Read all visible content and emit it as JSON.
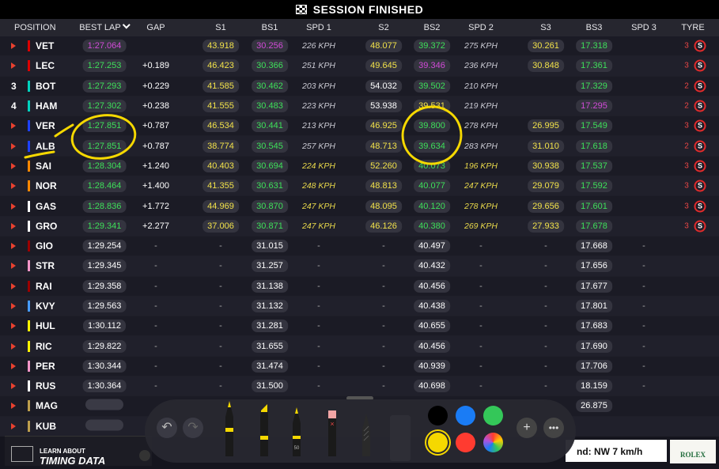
{
  "session": {
    "title": "SESSION FINISHED"
  },
  "columns": [
    "POSITION",
    "BEST LAP",
    "GAP",
    "S1",
    "BS1",
    "SPD 1",
    "S2",
    "BS2",
    "SPD 2",
    "S3",
    "BS3",
    "SPD 3",
    "TYRE"
  ],
  "colors": {
    "team_red": "#e8412f",
    "fastest_purple": "#d34bd9",
    "personal_green": "#3ee05a",
    "sector_yellow": "#f2e24a",
    "annotation_yellow": "#f5d800"
  },
  "rows": [
    {
      "pos": "",
      "team": "#dc0000",
      "driver": "VET",
      "lap": "1:27.064",
      "gap": "",
      "s1": "43.918",
      "bs1": "30.256",
      "spd1": "226 KPH",
      "s2": "48.077",
      "bs2": "39.372",
      "spd2": "275 KPH",
      "s3": "30.261",
      "bs3": "17.318",
      "spd3": "",
      "laps": "3",
      "tyre": "S"
    },
    {
      "pos": "",
      "team": "#dc0000",
      "driver": "LEC",
      "lap": "1:27.253",
      "gap": "+0.189",
      "s1": "46.423",
      "bs1": "30.366",
      "spd1": "251 KPH",
      "s2": "49.645",
      "bs2": "39.346",
      "spd2": "236 KPH",
      "s3": "30.848",
      "bs3": "17.361",
      "spd3": "",
      "laps": "3",
      "tyre": "S"
    },
    {
      "pos": "3",
      "team": "#00d2be",
      "driver": "BOT",
      "lap": "1:27.293",
      "gap": "+0.229",
      "s1": "41.585",
      "bs1": "30.462",
      "spd1": "203 KPH",
      "s2": "54.032",
      "bs2": "39.502",
      "spd2": "210 KPH",
      "s3": "",
      "bs3": "17.329",
      "spd3": "",
      "laps": "2",
      "tyre": "S"
    },
    {
      "pos": "4",
      "team": "#00d2be",
      "driver": "HAM",
      "lap": "1:27.302",
      "gap": "+0.238",
      "s1": "41.555",
      "bs1": "30.483",
      "spd1": "223 KPH",
      "s2": "53.938",
      "bs2": "39.531",
      "spd2": "219 KPH",
      "s3": "",
      "bs3": "17.295",
      "spd3": "",
      "laps": "2",
      "tyre": "S"
    },
    {
      "pos": "",
      "team": "#1e41ff",
      "driver": "VER",
      "lap": "1:27.851",
      "gap": "+0.787",
      "s1": "46.534",
      "bs1": "30.441",
      "spd1": "213 KPH",
      "s2": "46.925",
      "bs2": "39.800",
      "spd2": "278 KPH",
      "s3": "26.995",
      "bs3": "17.549",
      "spd3": "",
      "laps": "3",
      "tyre": "S"
    },
    {
      "pos": "",
      "team": "#1e41ff",
      "driver": "ALB",
      "lap": "1:27.851",
      "gap": "+0.787",
      "s1": "38.774",
      "bs1": "30.545",
      "spd1": "257 KPH",
      "s2": "48.713",
      "bs2": "39.634",
      "spd2": "283 KPH",
      "s3": "31.010",
      "bs3": "17.618",
      "spd3": "",
      "laps": "2",
      "tyre": "S"
    },
    {
      "pos": "",
      "team": "#ff8700",
      "driver": "SAI",
      "lap": "1:28.304",
      "gap": "+1.240",
      "s1": "40.403",
      "bs1": "30.694",
      "spd1": "224 KPH",
      "s2": "52.260",
      "bs2": "40.073",
      "spd2": "196 KPH",
      "s3": "30.938",
      "bs3": "17.537",
      "spd3": "",
      "laps": "3",
      "tyre": "S"
    },
    {
      "pos": "",
      "team": "#ff8700",
      "driver": "NOR",
      "lap": "1:28.464",
      "gap": "+1.400",
      "s1": "41.355",
      "bs1": "30.631",
      "spd1": "248 KPH",
      "s2": "48.813",
      "bs2": "40.077",
      "spd2": "247 KPH",
      "s3": "29.079",
      "bs3": "17.592",
      "spd3": "",
      "laps": "3",
      "tyre": "S"
    },
    {
      "pos": "",
      "team": "#ffffff",
      "driver": "GAS",
      "lap": "1:28.836",
      "gap": "+1.772",
      "s1": "44.969",
      "bs1": "30.870",
      "spd1": "247 KPH",
      "s2": "48.095",
      "bs2": "40.120",
      "spd2": "278 KPH",
      "s3": "29.656",
      "bs3": "17.601",
      "spd3": "",
      "laps": "3",
      "tyre": "S"
    },
    {
      "pos": "",
      "team": "#ffffff",
      "driver": "GRO",
      "lap": "1:29.341",
      "gap": "+2.277",
      "s1": "37.006",
      "bs1": "30.871",
      "spd1": "247 KPH",
      "s2": "46.126",
      "bs2": "40.380",
      "spd2": "269 KPH",
      "s3": "27.933",
      "bs3": "17.678",
      "spd3": "",
      "laps": "3",
      "tyre": "S"
    },
    {
      "pos": "",
      "team": "#9b0000",
      "driver": "GIO",
      "lap": "1:29.254",
      "gap": "-",
      "s1": "-",
      "bs1": "31.015",
      "spd1": "-",
      "s2": "-",
      "bs2": "40.497",
      "spd2": "-",
      "s3": "-",
      "bs3": "17.668",
      "spd3": "-",
      "laps": "",
      "tyre": ""
    },
    {
      "pos": "",
      "team": "#f596c8",
      "driver": "STR",
      "lap": "1:29.345",
      "gap": "-",
      "s1": "-",
      "bs1": "31.257",
      "spd1": "-",
      "s2": "-",
      "bs2": "40.432",
      "spd2": "-",
      "s3": "-",
      "bs3": "17.656",
      "spd3": "-",
      "laps": "",
      "tyre": ""
    },
    {
      "pos": "",
      "team": "#9b0000",
      "driver": "RAI",
      "lap": "1:29.358",
      "gap": "-",
      "s1": "-",
      "bs1": "31.138",
      "spd1": "-",
      "s2": "-",
      "bs2": "40.456",
      "spd2": "-",
      "s3": "-",
      "bs3": "17.677",
      "spd3": "-",
      "laps": "",
      "tyre": ""
    },
    {
      "pos": "",
      "team": "#469bff",
      "driver": "KVY",
      "lap": "1:29.563",
      "gap": "-",
      "s1": "-",
      "bs1": "31.132",
      "spd1": "-",
      "s2": "-",
      "bs2": "40.438",
      "spd2": "-",
      "s3": "-",
      "bs3": "17.801",
      "spd3": "-",
      "laps": "",
      "tyre": ""
    },
    {
      "pos": "",
      "team": "#fff500",
      "driver": "HUL",
      "lap": "1:30.112",
      "gap": "-",
      "s1": "-",
      "bs1": "31.281",
      "spd1": "-",
      "s2": "-",
      "bs2": "40.655",
      "spd2": "-",
      "s3": "-",
      "bs3": "17.683",
      "spd3": "-",
      "laps": "",
      "tyre": ""
    },
    {
      "pos": "",
      "team": "#fff500",
      "driver": "RIC",
      "lap": "1:29.822",
      "gap": "-",
      "s1": "-",
      "bs1": "31.655",
      "spd1": "-",
      "s2": "-",
      "bs2": "40.456",
      "spd2": "-",
      "s3": "-",
      "bs3": "17.690",
      "spd3": "-",
      "laps": "",
      "tyre": ""
    },
    {
      "pos": "",
      "team": "#f596c8",
      "driver": "PER",
      "lap": "1:30.344",
      "gap": "-",
      "s1": "-",
      "bs1": "31.474",
      "spd1": "-",
      "s2": "-",
      "bs2": "40.939",
      "spd2": "-",
      "s3": "-",
      "bs3": "17.706",
      "spd3": "-",
      "laps": "",
      "tyre": ""
    },
    {
      "pos": "",
      "team": "#ffffff",
      "driver": "RUS",
      "lap": "1:30.364",
      "gap": "-",
      "s1": "-",
      "bs1": "31.500",
      "spd1": "-",
      "s2": "-",
      "bs2": "40.698",
      "spd2": "-",
      "s3": "-",
      "bs3": "18.159",
      "spd3": "-",
      "laps": "",
      "tyre": ""
    },
    {
      "pos": "",
      "team": "#bd9e4c",
      "driver": "MAG",
      "lap": "",
      "gap": "",
      "s1": "",
      "bs1": "",
      "spd1": "",
      "s2": "",
      "bs2": "",
      "spd2": "",
      "s3": "",
      "bs3": "26.875",
      "spd3": "",
      "laps": "",
      "tyre": ""
    },
    {
      "pos": "",
      "team": "#bd9e4c",
      "driver": "KUB",
      "lap": "",
      "gap": "",
      "s1": "",
      "bs1": "",
      "spd1": "",
      "s2": "",
      "bs2": "",
      "spd2": "",
      "s3": "",
      "bs3": "",
      "spd3": "",
      "laps": "",
      "tyre": ""
    }
  ],
  "markup": {
    "tools": [
      "undo-icon",
      "redo-icon",
      "pen-icon",
      "marker-icon",
      "pencil-icon",
      "eraser-icon",
      "lasso-icon",
      "ruler-icon"
    ],
    "pencil_width": "50",
    "colors": [
      "#000000",
      "#1a7cf5",
      "#34c759",
      "#f5d800",
      "#ff3b30",
      "multicolor"
    ]
  },
  "footer": {
    "learn_small": "LEARN ABOUT",
    "learn_big": "TIMING DATA",
    "wind": "nd: NW 7 km/h",
    "sponsor": "ROLEX"
  }
}
